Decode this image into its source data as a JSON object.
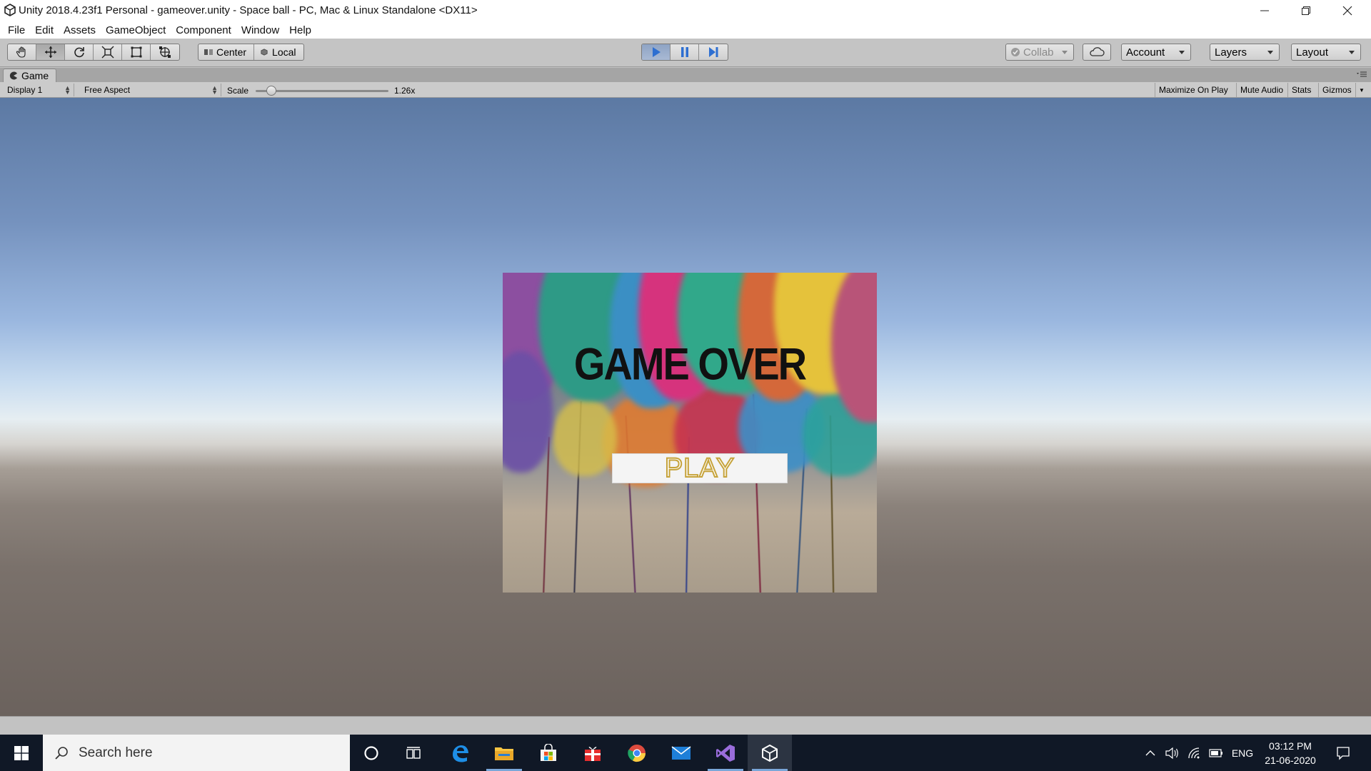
{
  "window": {
    "title": "Unity 2018.4.23f1 Personal - gameover.unity - Space ball - PC, Mac & Linux Standalone <DX11>"
  },
  "menu": [
    "File",
    "Edit",
    "Assets",
    "GameObject",
    "Component",
    "Window",
    "Help"
  ],
  "toolbar": {
    "tools": [
      "hand-tool",
      "move-tool",
      "rotate-tool",
      "scale-tool",
      "rect-tool",
      "transform-tool"
    ],
    "pivot_center": "Center",
    "pivot_local": "Local",
    "collab": "Collab",
    "account": "Account",
    "layers": "Layers",
    "layout": "Layout"
  },
  "game_panel": {
    "tab_label": "Game",
    "display": "Display 1",
    "aspect": "Free Aspect",
    "scale_label": "Scale",
    "scale_value": "1.26x",
    "scale_level": 0.12,
    "maximize_on_play": "Maximize On Play",
    "mute_audio": "Mute Audio",
    "stats": "Stats",
    "gizmos": "Gizmos"
  },
  "game_screen": {
    "heading": "GAME OVER",
    "play_button": "PLAY"
  },
  "taskbar": {
    "search_placeholder": "Search here",
    "pinned": [
      "cortana-icon",
      "task-view-icon",
      "edge-icon",
      "file-explorer-icon",
      "store-icon",
      "gift-app-icon",
      "chrome-icon",
      "mail-icon",
      "visual-studio-icon",
      "unity-icon"
    ],
    "language": "ENG",
    "time": "03:12 PM",
    "date": "21-06-2020"
  },
  "colors": {
    "play_active": "#3a78d6",
    "unity_chrome": "#c2c2c2",
    "taskbar": "#101826"
  }
}
